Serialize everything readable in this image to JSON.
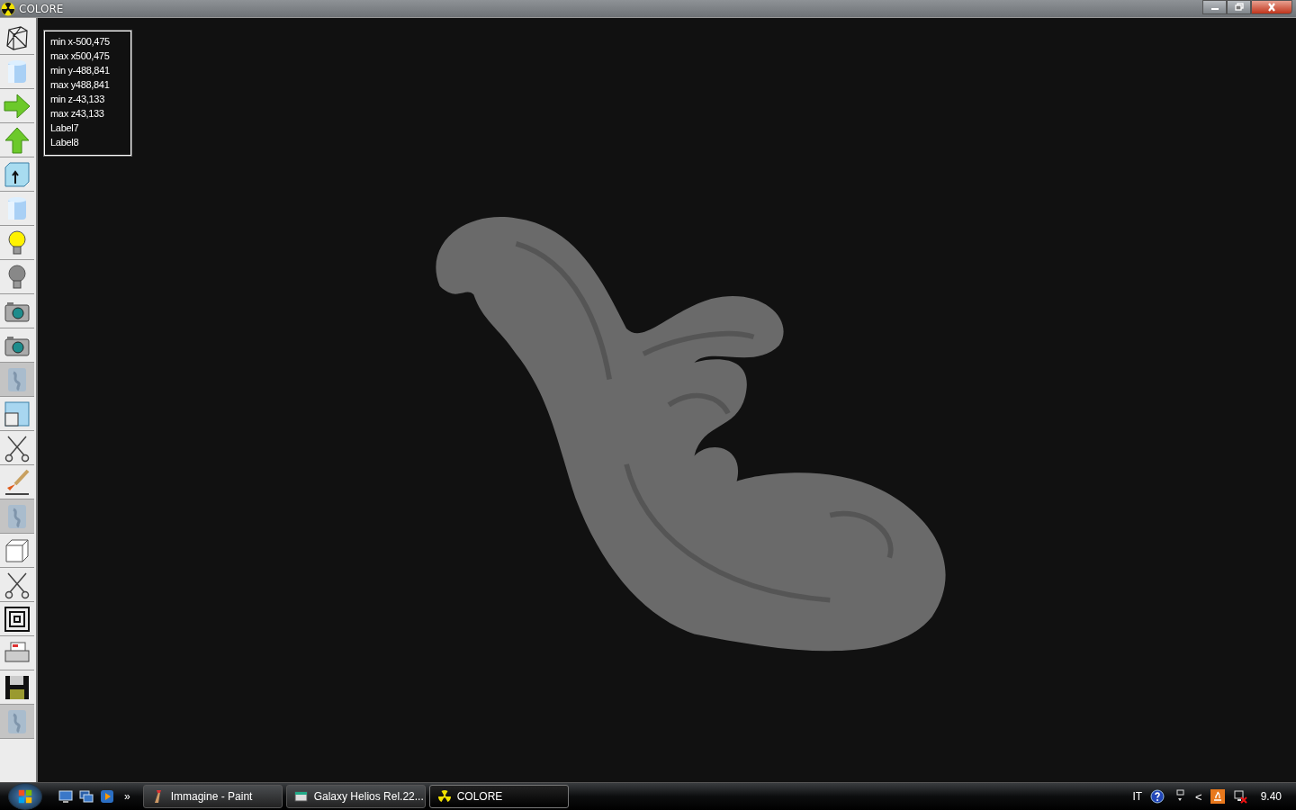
{
  "window": {
    "title": "COLORE"
  },
  "toolbar": [
    {
      "kind": "wireframe",
      "disabled": false
    },
    {
      "kind": "cylinder",
      "disabled": false
    },
    {
      "kind": "arrow-right",
      "disabled": false
    },
    {
      "kind": "arrow-up",
      "disabled": false
    },
    {
      "kind": "box-arrow",
      "disabled": false
    },
    {
      "kind": "cylinder",
      "disabled": false
    },
    {
      "kind": "bulb-on",
      "disabled": false
    },
    {
      "kind": "bulb-off",
      "disabled": false
    },
    {
      "kind": "camera",
      "disabled": false
    },
    {
      "kind": "camera",
      "disabled": false
    },
    {
      "kind": "blank",
      "disabled": true
    },
    {
      "kind": "viewport",
      "disabled": false
    },
    {
      "kind": "scissors",
      "disabled": false
    },
    {
      "kind": "brush",
      "disabled": false
    },
    {
      "kind": "blank",
      "disabled": true
    },
    {
      "kind": "cube",
      "disabled": false
    },
    {
      "kind": "scissors",
      "disabled": false
    },
    {
      "kind": "target",
      "disabled": false
    },
    {
      "kind": "printer",
      "disabled": false
    },
    {
      "kind": "floppy",
      "disabled": false
    },
    {
      "kind": "blank",
      "disabled": true
    }
  ],
  "info_labels": [
    "min x-500,475",
    "max x500,475",
    "min y-488,841",
    "max y488,841",
    "min z-43,133",
    "max z43,133",
    "Label7",
    "Label8"
  ],
  "taskbar": {
    "overflow": "»",
    "tasks": [
      {
        "label": "Immagine - Paint",
        "kind": "paint",
        "selected": false
      },
      {
        "label": "Galaxy Helios  Rel.22...",
        "kind": "window",
        "selected": false
      },
      {
        "label": "COLORE",
        "kind": "radiation",
        "selected": true
      }
    ],
    "language": "IT",
    "tray_chevron": "<",
    "clock": "9.40"
  }
}
